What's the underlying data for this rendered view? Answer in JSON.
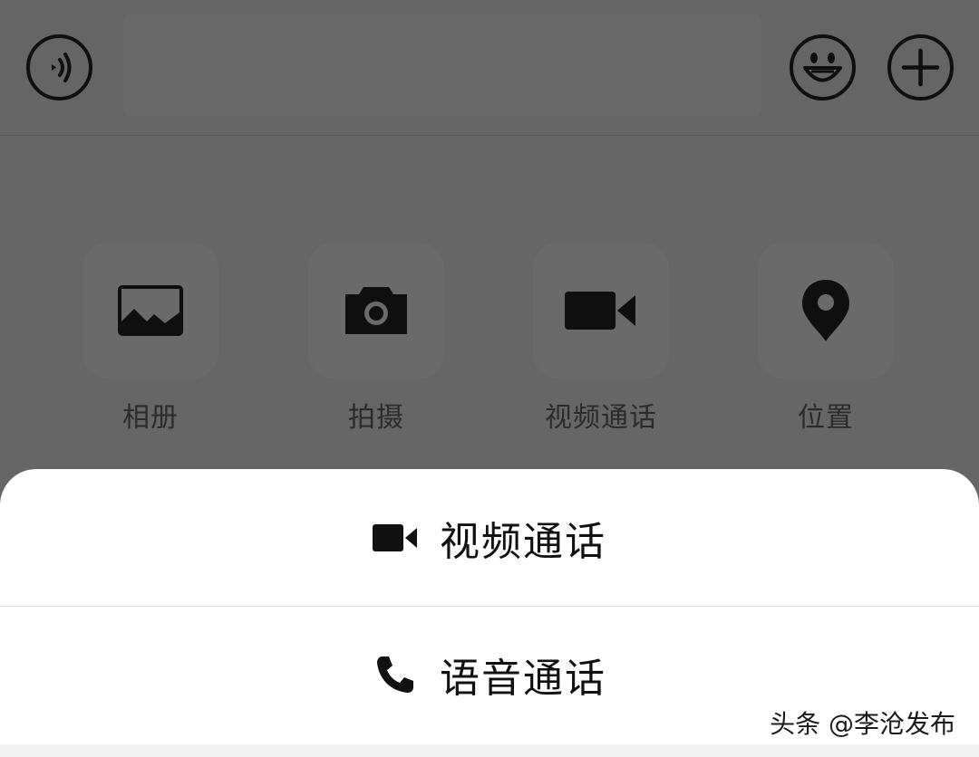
{
  "input_bar": {
    "voice_icon": "voice-icon",
    "emoji_icon": "emoji-icon",
    "plus_icon": "plus-icon",
    "text_value": ""
  },
  "actions": [
    {
      "label": "相册",
      "icon": "photo-album-icon"
    },
    {
      "label": "拍摄",
      "icon": "camera-icon"
    },
    {
      "label": "视频通话",
      "icon": "video-camera-icon"
    },
    {
      "label": "位置",
      "icon": "location-pin-icon"
    }
  ],
  "sheet": {
    "options": [
      {
        "label": "视频通话",
        "icon": "video-camera-icon"
      },
      {
        "label": "语音通话",
        "icon": "phone-icon"
      }
    ]
  },
  "watermark": "头条 @李沧发布",
  "colors": {
    "dim_overlay": "#666666",
    "sheet_bg": "#ffffff",
    "icon": "#0f0f0f"
  }
}
